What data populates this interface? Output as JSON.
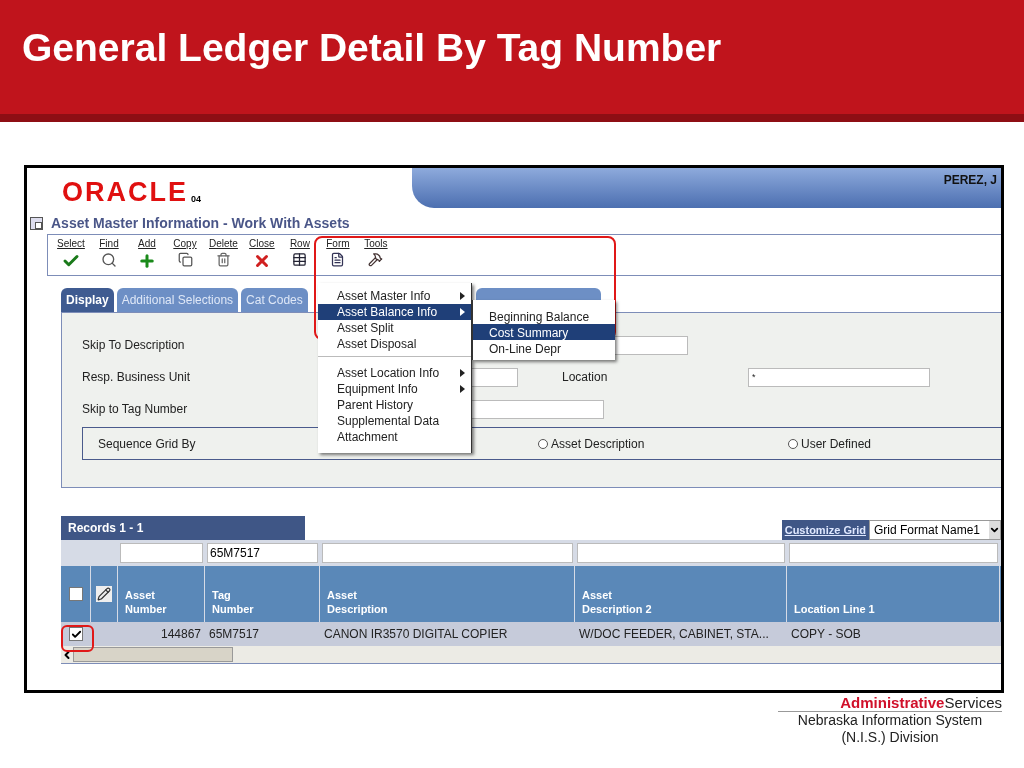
{
  "slide": {
    "title": "General Ledger Detail By Tag Number"
  },
  "app": {
    "logo": "ORACLE",
    "version": "04",
    "user": "PEREZ, J",
    "form_title": "Asset Master Information - Work With Assets",
    "toolbar": [
      {
        "label": "Select",
        "kind": "select"
      },
      {
        "label": "Find",
        "kind": "find"
      },
      {
        "label": "Add",
        "kind": "add"
      },
      {
        "label": "Copy",
        "kind": "copy"
      },
      {
        "label": "Delete",
        "kind": "delete"
      },
      {
        "label": "Close",
        "kind": "close"
      },
      {
        "label": "Row",
        "kind": "row"
      },
      {
        "label": "Form",
        "kind": "form"
      },
      {
        "label": "Tools",
        "kind": "tools"
      }
    ],
    "tabs": [
      {
        "label": "Display",
        "selected": true
      },
      {
        "label": "Additional Selections",
        "selected": false
      },
      {
        "label": "Cat Codes",
        "selected": false
      },
      {
        "selected": false
      }
    ],
    "form": {
      "skip_description": "Skip To Description",
      "business_unit": "Resp. Business Unit",
      "location": {
        "label": "Location",
        "value": "*"
      },
      "skip_tag": "Skip to Tag Number",
      "sequence": {
        "label": "Sequence Grid By",
        "options": [
          {
            "label": "Asset Description",
            "selected": false
          },
          {
            "label": "User Defined",
            "selected": false
          }
        ]
      }
    },
    "row_menu": {
      "groups": [
        [
          {
            "label": "Asset Master Info",
            "submenu": true,
            "selected": false
          },
          {
            "label": "Asset Balance Info",
            "submenu": true,
            "selected": true
          },
          {
            "label": "Asset Split",
            "submenu": false,
            "selected": false
          },
          {
            "label": "Asset Disposal",
            "submenu": false,
            "selected": false
          }
        ],
        [
          {
            "label": "Asset Location Info",
            "submenu": true,
            "selected": false
          },
          {
            "label": "Equipment Info",
            "submenu": true,
            "selected": false
          },
          {
            "label": "Parent History",
            "submenu": false,
            "selected": false
          },
          {
            "label": "Supplemental Data",
            "submenu": false,
            "selected": false
          },
          {
            "label": "Attachment",
            "submenu": false,
            "selected": false
          }
        ]
      ]
    },
    "submenu": {
      "items": [
        {
          "label": "Beginning Balance",
          "selected": false
        },
        {
          "label": "Cost Summary",
          "selected": true
        },
        {
          "label": "On-Line Depr",
          "selected": false
        }
      ]
    },
    "grid": {
      "records": "Records 1 - 1",
      "customize": "Customize Grid",
      "format": "Grid Format Name1",
      "tag_filter": "65M7517",
      "header_checked": false,
      "columns": [
        {
          "lines": [
            "Asset",
            "Number"
          ]
        },
        {
          "lines": [
            "Tag",
            "Number"
          ]
        },
        {
          "lines": [
            "Asset",
            "Description"
          ]
        },
        {
          "lines": [
            "Asset",
            "Description 2"
          ]
        },
        {
          "lines": [
            "Location Line 1"
          ]
        }
      ],
      "rows": [
        {
          "checked": true,
          "cells": [
            "144867",
            "65M7517",
            "CANON IR3570 DIGITAL COPIER",
            "W/DOC FEEDER, CABINET, STA...",
            "COPY - SOB"
          ]
        }
      ]
    }
  },
  "footer": {
    "org_bold": "Administrative",
    "org_rest": "Services",
    "lines": [
      "Nebraska Information System",
      "(N.I.S.) Division"
    ]
  }
}
